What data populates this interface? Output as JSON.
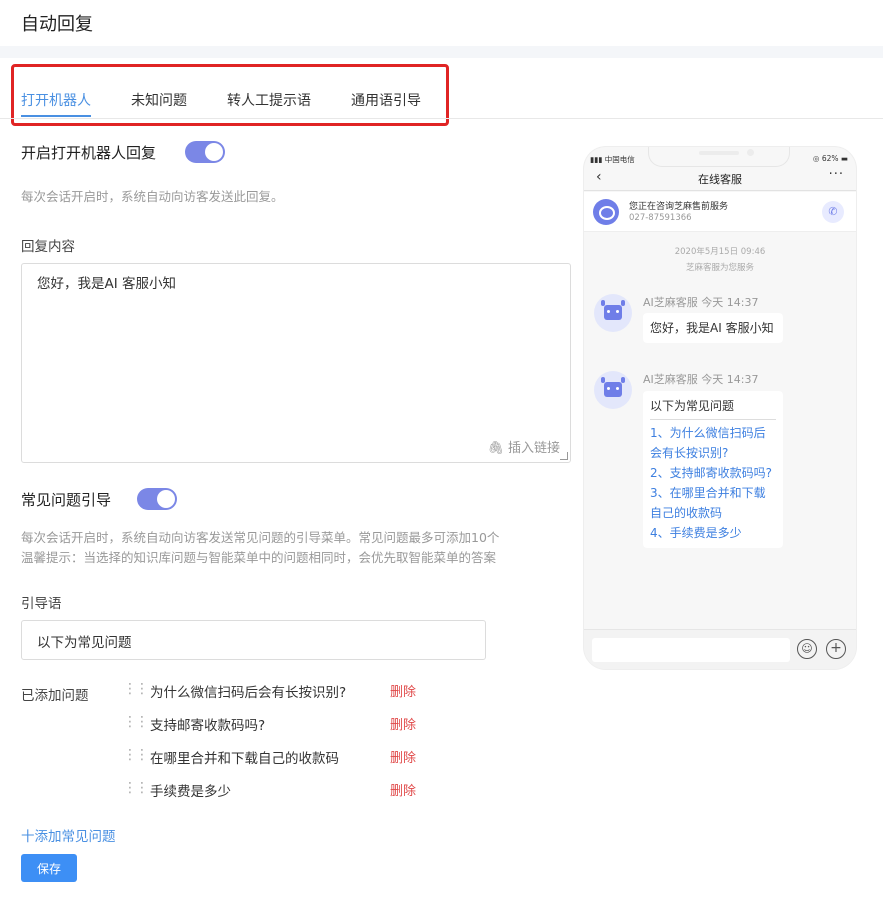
{
  "page": {
    "title": "自动回复"
  },
  "tabs": [
    {
      "label": "打开机器人",
      "active": true
    },
    {
      "label": "未知问题",
      "active": false
    },
    {
      "label": "转人工提示语",
      "active": false
    },
    {
      "label": "通用语引导",
      "active": false
    }
  ],
  "bot_reply": {
    "title": "开启打开机器人回复",
    "enabled": true,
    "hint": "每次会话开启时，系统自动向访客发送此回复。",
    "content_label": "回复内容",
    "content": "您好，我是AI 客服小知",
    "insert_link": "插入链接"
  },
  "faq_guide": {
    "title": "常见问题引导",
    "enabled": true,
    "hint_1": "每次会话开启时，系统自动向访客发送常见问题的引导菜单。常见问题最多可添加10个",
    "hint_2": "温馨提示：当选择的知识库问题与智能菜单中的问题相同时，会优先取智能菜单的答案",
    "guide_label": "引导语",
    "guide_value": "以下为常见问题",
    "added_label": "已添加问题",
    "delete_label": "删除",
    "questions": [
      "为什么微信扫码后会有长按识别?",
      "支持邮寄收款码吗?",
      "在哪里合并和下载自己的收款码",
      "手续费是多少"
    ],
    "add_label": "十添加常见问题",
    "save_label": "保存"
  },
  "phone": {
    "status_left": "中国电信",
    "status_right": "62%",
    "nav_title": "在线客服",
    "consult_name": "您正在咨询芝麻售前服务",
    "consult_phone": "027-87591366",
    "date": "2020年5月15日 09:46",
    "sys_msg": "芝麻客服为您服务",
    "msg1_meta": "AI芝麻客服 今天 14:37",
    "msg1_text": "您好，我是AI 客服小知",
    "msg2_meta": "AI芝麻客服 今天 14:37",
    "msg2_title": "以下为常见问题",
    "msg2_items": [
      "1、为什么微信扫码后会有长按识别?",
      "2、支持邮寄收款码吗?",
      "3、在哪里合并和下载自己的收款码",
      "4、手续费是多少"
    ]
  },
  "colors": {
    "accent": "#4a90e2",
    "toggle": "#7b87e6",
    "danger": "#e04848",
    "highlight": "#e02424"
  }
}
